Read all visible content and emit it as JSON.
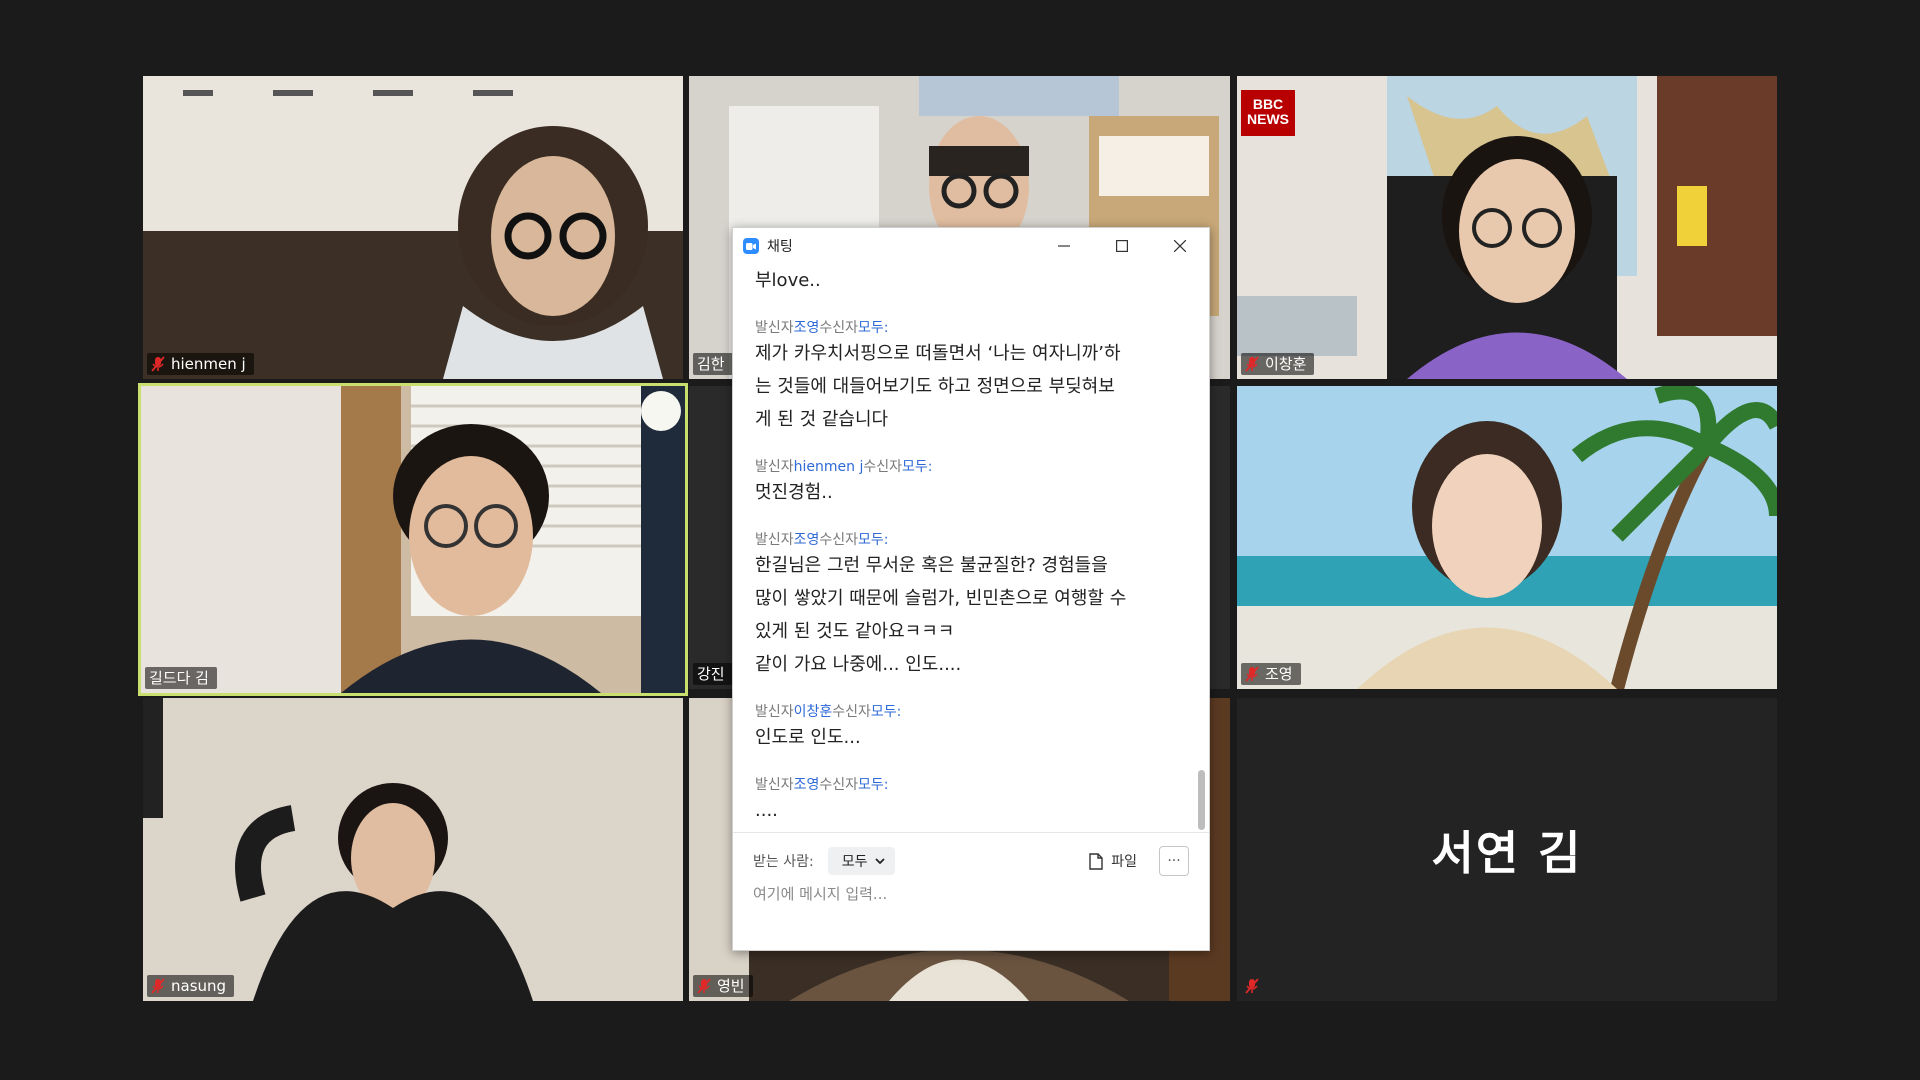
{
  "participants": [
    {
      "name": "hienmen j",
      "muted": true
    },
    {
      "name": "김한",
      "muted": false
    },
    {
      "name": "이창훈",
      "muted": true
    },
    {
      "name": "길드다 김",
      "muted": false,
      "active_speaker": true
    },
    {
      "name": "강진",
      "muted": false
    },
    {
      "name": "조영",
      "muted": true
    },
    {
      "name": "nasung",
      "muted": true
    },
    {
      "name": "영빈",
      "muted": true
    },
    {
      "name": "",
      "muted": true,
      "display_name_large": "서연 김"
    }
  ],
  "bbc_logo": {
    "line1": "BBC",
    "line2": "NEWS"
  },
  "chat": {
    "title": "채팅",
    "first_line": "부love..",
    "messages": [
      {
        "from_label": "발신자",
        "sender": "조영",
        "to_label": "수신자",
        "recipient": "모두:",
        "lines": [
          "제가 카우치서핑으로 떠돌면서 ‘나는 여자니까’하",
          "는 것들에 대들어보기도 하고 정면으로 부딪혀보",
          "게 된 것 같습니다"
        ]
      },
      {
        "from_label": "발신자",
        "sender": "hienmen j",
        "to_label": "수신자",
        "recipient": "모두:",
        "lines": [
          "멋진경험.."
        ]
      },
      {
        "from_label": "발신자",
        "sender": "조영",
        "to_label": "수신자",
        "recipient": "모두:",
        "lines": [
          "한길님은 그런 무서운 혹은 불균질한? 경험들을",
          "많이 쌓았기 때문에 슬럼가, 빈민촌으로 여행할 수",
          "있게 된 것도 같아요ㅋㅋㅋ",
          "같이 가요 나중에... 인도...."
        ]
      },
      {
        "from_label": "발신자",
        "sender": "이창훈",
        "to_label": "수신자",
        "recipient": "모두:",
        "lines": [
          "인도로 인도..."
        ]
      },
      {
        "from_label": "발신자",
        "sender": "조영",
        "to_label": "수신자",
        "recipient": "모두:",
        "lines": [
          "...."
        ]
      }
    ],
    "to_label": "받는 사람:",
    "recipient_select": "모두",
    "file_label": "파일",
    "more_label": "···",
    "input_placeholder": "여기에 메시지 입력..."
  },
  "colors": {
    "background": "#1b1b1b",
    "active_border": "#c9e06e",
    "link_blue": "#2d6ad6",
    "muted_red": "#e02828"
  }
}
